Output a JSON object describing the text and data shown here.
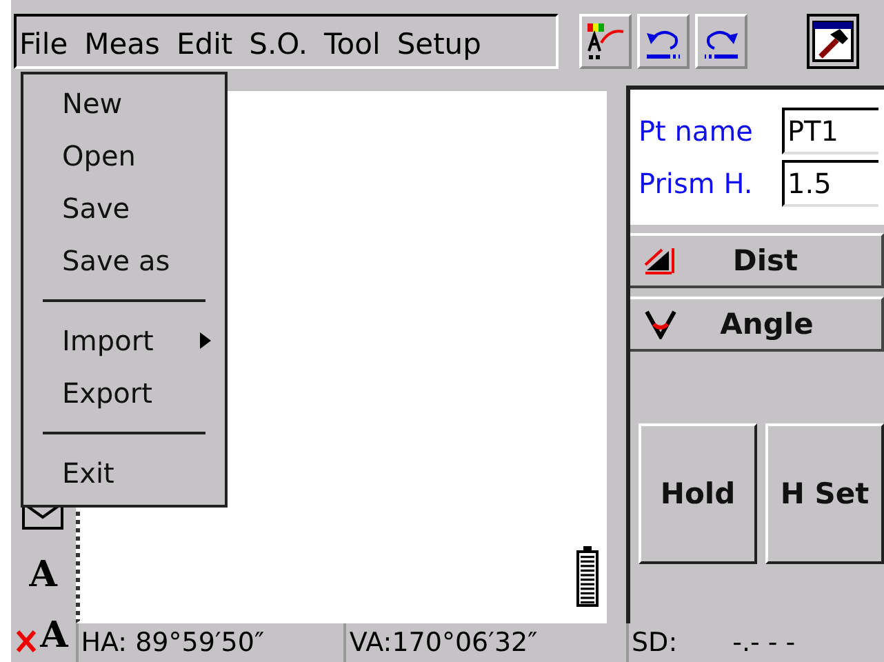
{
  "menu_bar": [
    "File",
    "Meas",
    "Edit",
    "S.O.",
    "Tool",
    "Setup"
  ],
  "file_menu": [
    {
      "kind": "item",
      "label": "New"
    },
    {
      "kind": "item",
      "label": "Open"
    },
    {
      "kind": "item",
      "label": "Save"
    },
    {
      "kind": "item",
      "label": "Save as"
    },
    {
      "kind": "separator"
    },
    {
      "kind": "submenu",
      "label": "Import"
    },
    {
      "kind": "item",
      "label": "Export"
    },
    {
      "kind": "separator"
    },
    {
      "kind": "item",
      "label": "Exit"
    }
  ],
  "left_tools": [
    {
      "kind": "font",
      "label": "A"
    },
    {
      "kind": "font-off",
      "label": "A"
    }
  ],
  "fields": [
    {
      "label": "Pt name",
      "value": "PT1"
    },
    {
      "label": "Prism H.",
      "value": "1.5"
    }
  ],
  "modes": [
    {
      "kind": "dist",
      "label": "Dist"
    },
    {
      "kind": "angle",
      "label": "Angle"
    }
  ],
  "buttons": [
    "Hold",
    "H Set"
  ],
  "status_bar": [
    {
      "label": "HA: 89°59′50″"
    },
    {
      "label": "VA:170°06′32″"
    },
    {
      "label": "SD:",
      "value": "-.- - -"
    }
  ]
}
